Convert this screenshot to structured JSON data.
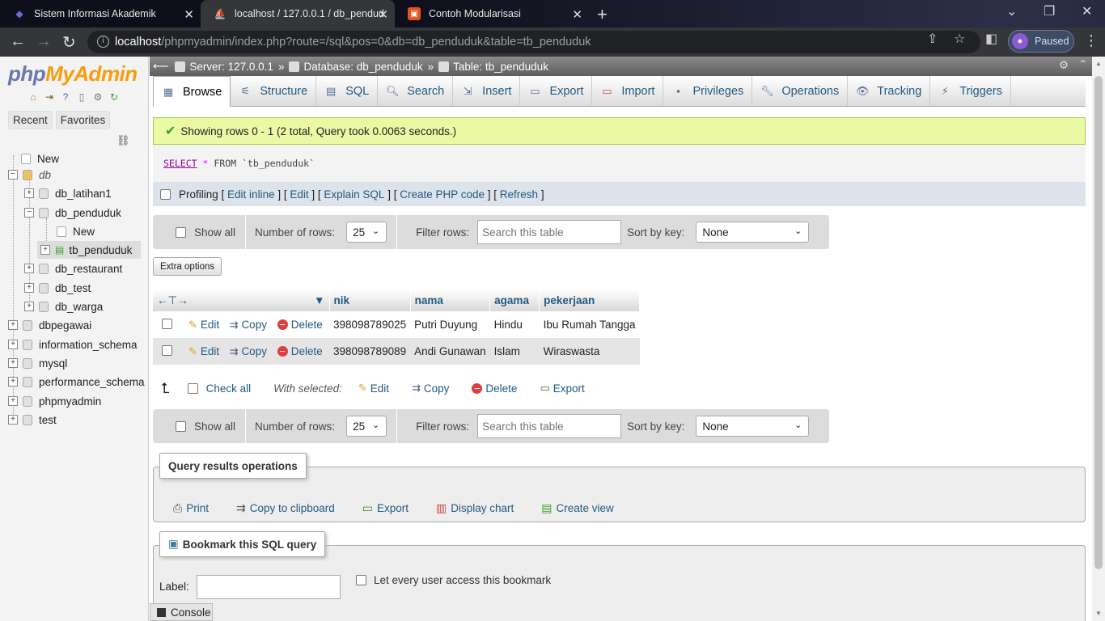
{
  "browser": {
    "tabs": [
      {
        "title": "Sistem Informasi Akademik"
      },
      {
        "title": "localhost / 127.0.0.1 / db_pendud"
      },
      {
        "title": "Contoh Modularisasi"
      }
    ],
    "url_host": "localhost",
    "url_path": "/phpmyadmin/index.php?route=/sql&pos=0&db=db_penduduk&table=tb_penduduk",
    "profile_status": "Paused"
  },
  "leftnav": {
    "logo_php": "php",
    "logo_my": "My",
    "logo_admin": "Admin",
    "recent": "Recent",
    "favorites": "Favorites",
    "tree": [
      "New",
      "db",
      "db_latihan1",
      "db_penduduk",
      "New",
      "tb_penduduk",
      "db_restaurant",
      "db_test",
      "db_warga",
      "dbpegawai",
      "information_schema",
      "mysql",
      "performance_schema",
      "phpmyadmin",
      "test"
    ]
  },
  "breadcrumb": {
    "server": "Server: 127.0.0.1",
    "database": "Database: db_penduduk",
    "table": "Table: tb_penduduk"
  },
  "tabs": [
    "Browse",
    "Structure",
    "SQL",
    "Search",
    "Insert",
    "Export",
    "Import",
    "Privileges",
    "Operations",
    "Tracking",
    "Triggers"
  ],
  "message": "Showing rows 0 - 1 (2 total, Query took 0.0063 seconds.)",
  "sql": {
    "select": "SELECT",
    "star": "*",
    "from": "FROM",
    "table": "`tb_penduduk`"
  },
  "profiling": {
    "label": "Profiling",
    "links": [
      "Edit inline",
      "Edit",
      "Explain SQL",
      "Create PHP code",
      "Refresh"
    ]
  },
  "nav": {
    "show_all": "Show all",
    "number_of_rows": "Number of rows:",
    "rows_value": "25",
    "filter_rows": "Filter rows:",
    "search_placeholder": "Search this table",
    "sort_by_key": "Sort by key:",
    "sort_value": "None"
  },
  "extra_options": "Extra options",
  "table": {
    "columns": [
      "nik",
      "nama",
      "agama",
      "pekerjaan"
    ],
    "actions": {
      "edit": "Edit",
      "copy": "Copy",
      "delete": "Delete"
    },
    "rows": [
      {
        "nik": "398098789025",
        "nama": "Putri Duyung",
        "agama": "Hindu",
        "pekerjaan": "Ibu Rumah Tangga"
      },
      {
        "nik": "398098789089",
        "nama": "Andi Gunawan",
        "agama": "Islam",
        "pekerjaan": "Wiraswasta"
      }
    ]
  },
  "with_selected": {
    "check_all": "Check all",
    "label": "With selected:",
    "edit": "Edit",
    "copy": "Copy",
    "delete": "Delete",
    "export": "Export"
  },
  "query_ops": {
    "title": "Query results operations",
    "items": [
      "Print",
      "Copy to clipboard",
      "Export",
      "Display chart",
      "Create view"
    ]
  },
  "bookmark": {
    "title": "Bookmark this SQL query",
    "label": "Label:",
    "share": "Let every user access this bookmark"
  },
  "console": "Console"
}
